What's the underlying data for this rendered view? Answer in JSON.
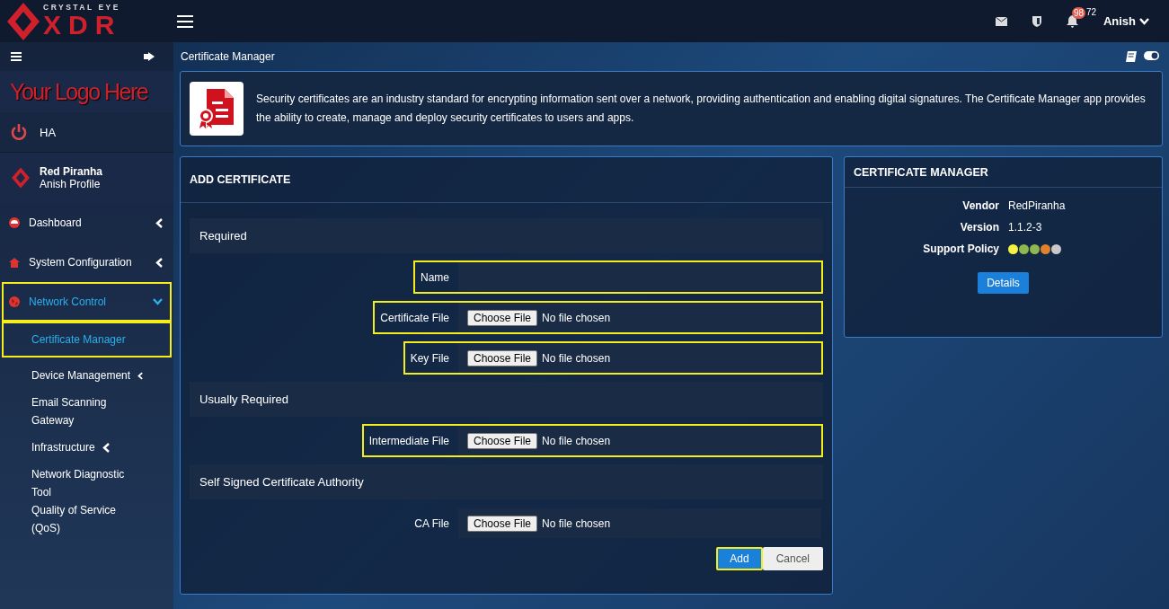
{
  "brand": {
    "small": "CRYSTAL EYE",
    "big": "XDR"
  },
  "topbar": {
    "notification_badge": "98",
    "notification_count": "72",
    "user": "Anish"
  },
  "sidebar": {
    "logo_text": "Your Logo Here",
    "ha": "HA",
    "profile": {
      "name": "Red Piranha",
      "sub": "Anish Profile"
    },
    "items": [
      {
        "label": "Dashboard",
        "kind": "gauge",
        "expanded": false,
        "has_arrow": true,
        "selected": false,
        "highlighted": false
      },
      {
        "label": "System Configuration",
        "kind": "home",
        "expanded": false,
        "has_arrow": true,
        "selected": false,
        "highlighted": false
      },
      {
        "label": "Network Control",
        "kind": "globe",
        "expanded": true,
        "has_arrow": true,
        "selected": true,
        "highlighted": true,
        "children": [
          {
            "label": "Certificate Manager",
            "has_arrow": false,
            "selected": true,
            "highlighted": true
          },
          {
            "label": "Device Management",
            "has_arrow": true,
            "selected": false,
            "highlighted": false
          },
          {
            "label": "Email Scanning Gateway",
            "has_arrow": false,
            "selected": false,
            "highlighted": false
          },
          {
            "label": "Infrastructure",
            "has_arrow": true,
            "selected": false,
            "highlighted": false
          },
          {
            "label": "Network Diagnostic Tool",
            "has_arrow": false,
            "selected": false,
            "highlighted": false
          },
          {
            "label": "Quality of Service (QoS)",
            "has_arrow": false,
            "selected": false,
            "highlighted": false
          }
        ]
      }
    ]
  },
  "page_title": "Certificate Manager",
  "intro": "Security certificates are an industry standard for encrypting information sent over a network, providing authentication and enabling digital signatures. The Certificate Manager app provides the ability to create, manage and deploy security certificates to users and apps.",
  "form": {
    "title": "ADD CERTIFICATE",
    "sections": [
      {
        "title": "Required",
        "rows": [
          {
            "label": "Name",
            "kind": "text",
            "highlighted": true
          },
          {
            "label": "Certificate File",
            "kind": "file",
            "button": "Choose File",
            "value": "No file chosen",
            "highlighted": true
          },
          {
            "label": "Key File",
            "kind": "file",
            "button": "Choose File",
            "value": "No file chosen",
            "highlighted": true
          }
        ]
      },
      {
        "title": "Usually Required",
        "rows": [
          {
            "label": "Intermediate File",
            "kind": "file",
            "button": "Choose File",
            "value": "No file chosen",
            "highlighted": true
          }
        ]
      },
      {
        "title": "Self Signed Certificate Authority",
        "rows": [
          {
            "label": "CA File",
            "kind": "file",
            "button": "Choose File",
            "value": "No file chosen",
            "highlighted": false
          }
        ]
      }
    ],
    "buttons": [
      {
        "label": "Add",
        "kind": "primary",
        "highlighted": true
      },
      {
        "label": "Cancel",
        "kind": "default",
        "highlighted": false
      }
    ]
  },
  "info": {
    "title": "CERTIFICATE MANAGER",
    "rows": [
      {
        "label": "Vendor",
        "value": "RedPiranha"
      },
      {
        "label": "Version",
        "value": "1.1.2-3"
      }
    ],
    "policy_label": "Support Policy",
    "policy_dots": [
      {
        "color": "#f4f142"
      },
      {
        "color": "#8fb84f"
      },
      {
        "color": "#8fb84f"
      },
      {
        "color": "#e2802c"
      },
      {
        "color": "#c8c8c8"
      }
    ],
    "button": "Details"
  }
}
